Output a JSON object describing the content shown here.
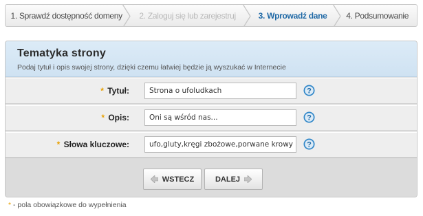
{
  "steps": [
    {
      "label": "1. Sprawdź dostępność domeny",
      "state": "done"
    },
    {
      "label": "2. Zaloguj się lub zarejestruj",
      "state": "disabled"
    },
    {
      "label": "3. Wprowadź dane",
      "state": "active"
    },
    {
      "label": "4. Podsumowanie",
      "state": "upcoming"
    }
  ],
  "panel": {
    "title": "Tematyka strony",
    "subtitle": "Podaj tytuł i opis swojej strony, dzięki czemu łatwiej będzie ją wyszukać w Internecie"
  },
  "form": {
    "required_mark": "*",
    "title": {
      "label": "Tytuł:",
      "value": "Strona o ufoludkach"
    },
    "description": {
      "label": "Opis:",
      "value": "Oni są wśród nas..."
    },
    "keywords": {
      "label": "Słowa kluczowe:",
      "value": "ufo,gluty,kręgi zbożowe,porwane krowy"
    }
  },
  "buttons": {
    "back": "WSTECZ",
    "next": "DALEJ"
  },
  "note": {
    "mark": "*",
    "text": " - pola obowiązkowe do wypełnienia"
  },
  "colors": {
    "accent": "#1f69a6",
    "required": "#e8a000",
    "help_icon": "#2f86c8"
  }
}
